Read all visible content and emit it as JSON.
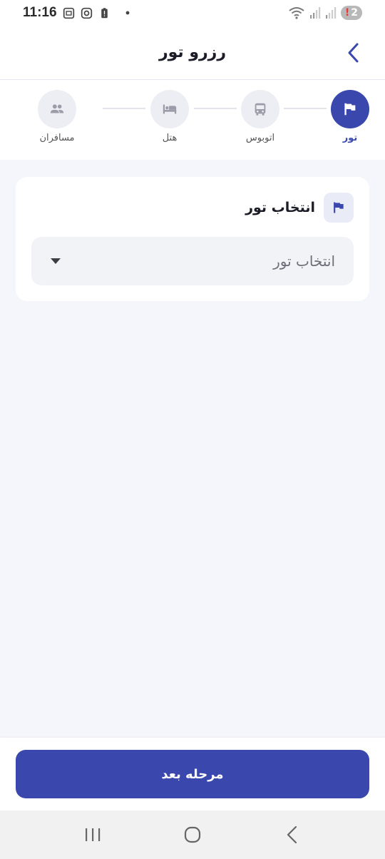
{
  "status_bar": {
    "time": "11:16",
    "notification_count": "2",
    "alert_mark": "!"
  },
  "header": {
    "title": "رزرو تور"
  },
  "stepper": {
    "steps": [
      {
        "label": "تور",
        "icon": "flag-icon",
        "active": true
      },
      {
        "label": "اتوبوس",
        "icon": "bus-icon",
        "active": false
      },
      {
        "label": "هتل",
        "icon": "bed-icon",
        "active": false
      },
      {
        "label": "مسافران",
        "icon": "people-icon",
        "active": false
      }
    ]
  },
  "card": {
    "title": "انتخاب تور",
    "select_placeholder": "انتخاب تور"
  },
  "footer": {
    "next_label": "مرحله بعد"
  },
  "colors": {
    "primary": "#3a48ad",
    "background": "#f5f6fb",
    "inactive_step": "#eceef4"
  }
}
